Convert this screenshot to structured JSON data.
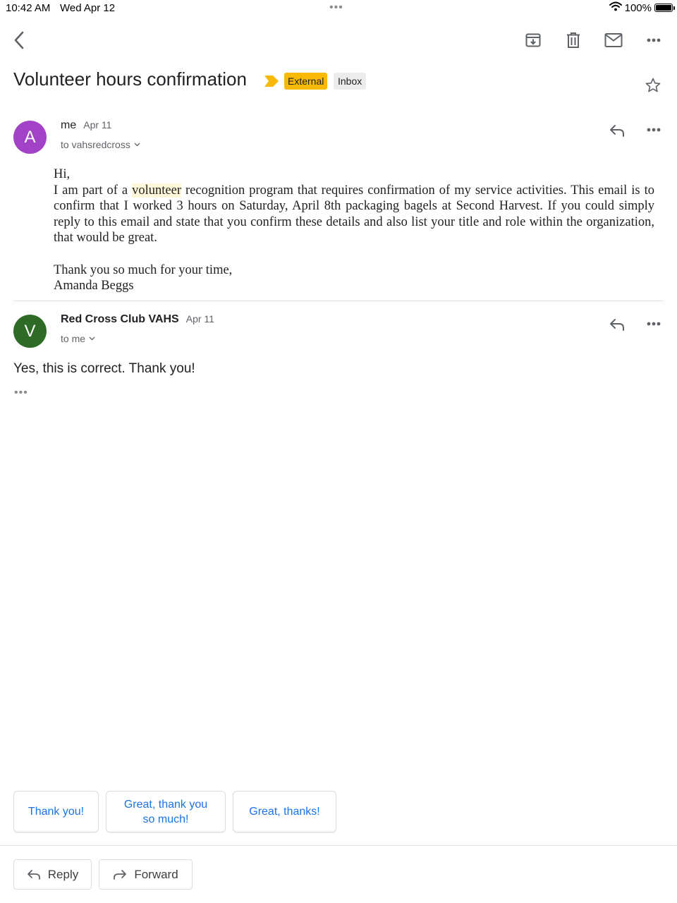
{
  "status_bar": {
    "time": "10:42 AM",
    "date": "Wed Apr 12",
    "multitask_dots": "•••",
    "battery": "100%",
    "icons": [
      "wifi-icon",
      "battery-icon"
    ]
  },
  "toolbar": {
    "icons": [
      "back-icon",
      "archive-icon",
      "delete-icon",
      "mark-unread-icon",
      "more-icon"
    ]
  },
  "email": {
    "subject": "Volunteer hours confirmation",
    "labels": {
      "external": "External",
      "inbox": "Inbox"
    },
    "colors": {
      "external_label": "#f9ba07",
      "important_marker": "#f9ba07",
      "link_blue": "#1a73e8"
    }
  },
  "messages": [
    {
      "avatar_letter": "A",
      "avatar_color": "#a142c7",
      "sender": "me",
      "date": "Apr 11",
      "recipient": "to vahsredcross",
      "greeting": "Hi,",
      "body_before": "I am part of a ",
      "body_highlight": "volunteer",
      "body_after": " recognition program that requires confirmation of my service activities. This email is to confirm that I worked 3 hours on Saturday, April 8th packaging bagels at Second Harvest. If you could simply reply to this email and state that you confirm these details and also list your title and role within the organization, that would be great.",
      "closing": "Thank you so much for your time,",
      "signature": "Amanda Beggs"
    },
    {
      "avatar_letter": "V",
      "avatar_color": "#2e6b26",
      "sender": "Red Cross Club VAHS",
      "date": "Apr 11",
      "recipient": "to me",
      "body": "Yes, this is correct. Thank you!",
      "trimmed_indicator": "•••"
    }
  ],
  "smart_replies": [
    "Thank you!",
    "Great, thank you so much!",
    "Great, thanks!"
  ],
  "actions": {
    "reply": "Reply",
    "forward": "Forward"
  }
}
